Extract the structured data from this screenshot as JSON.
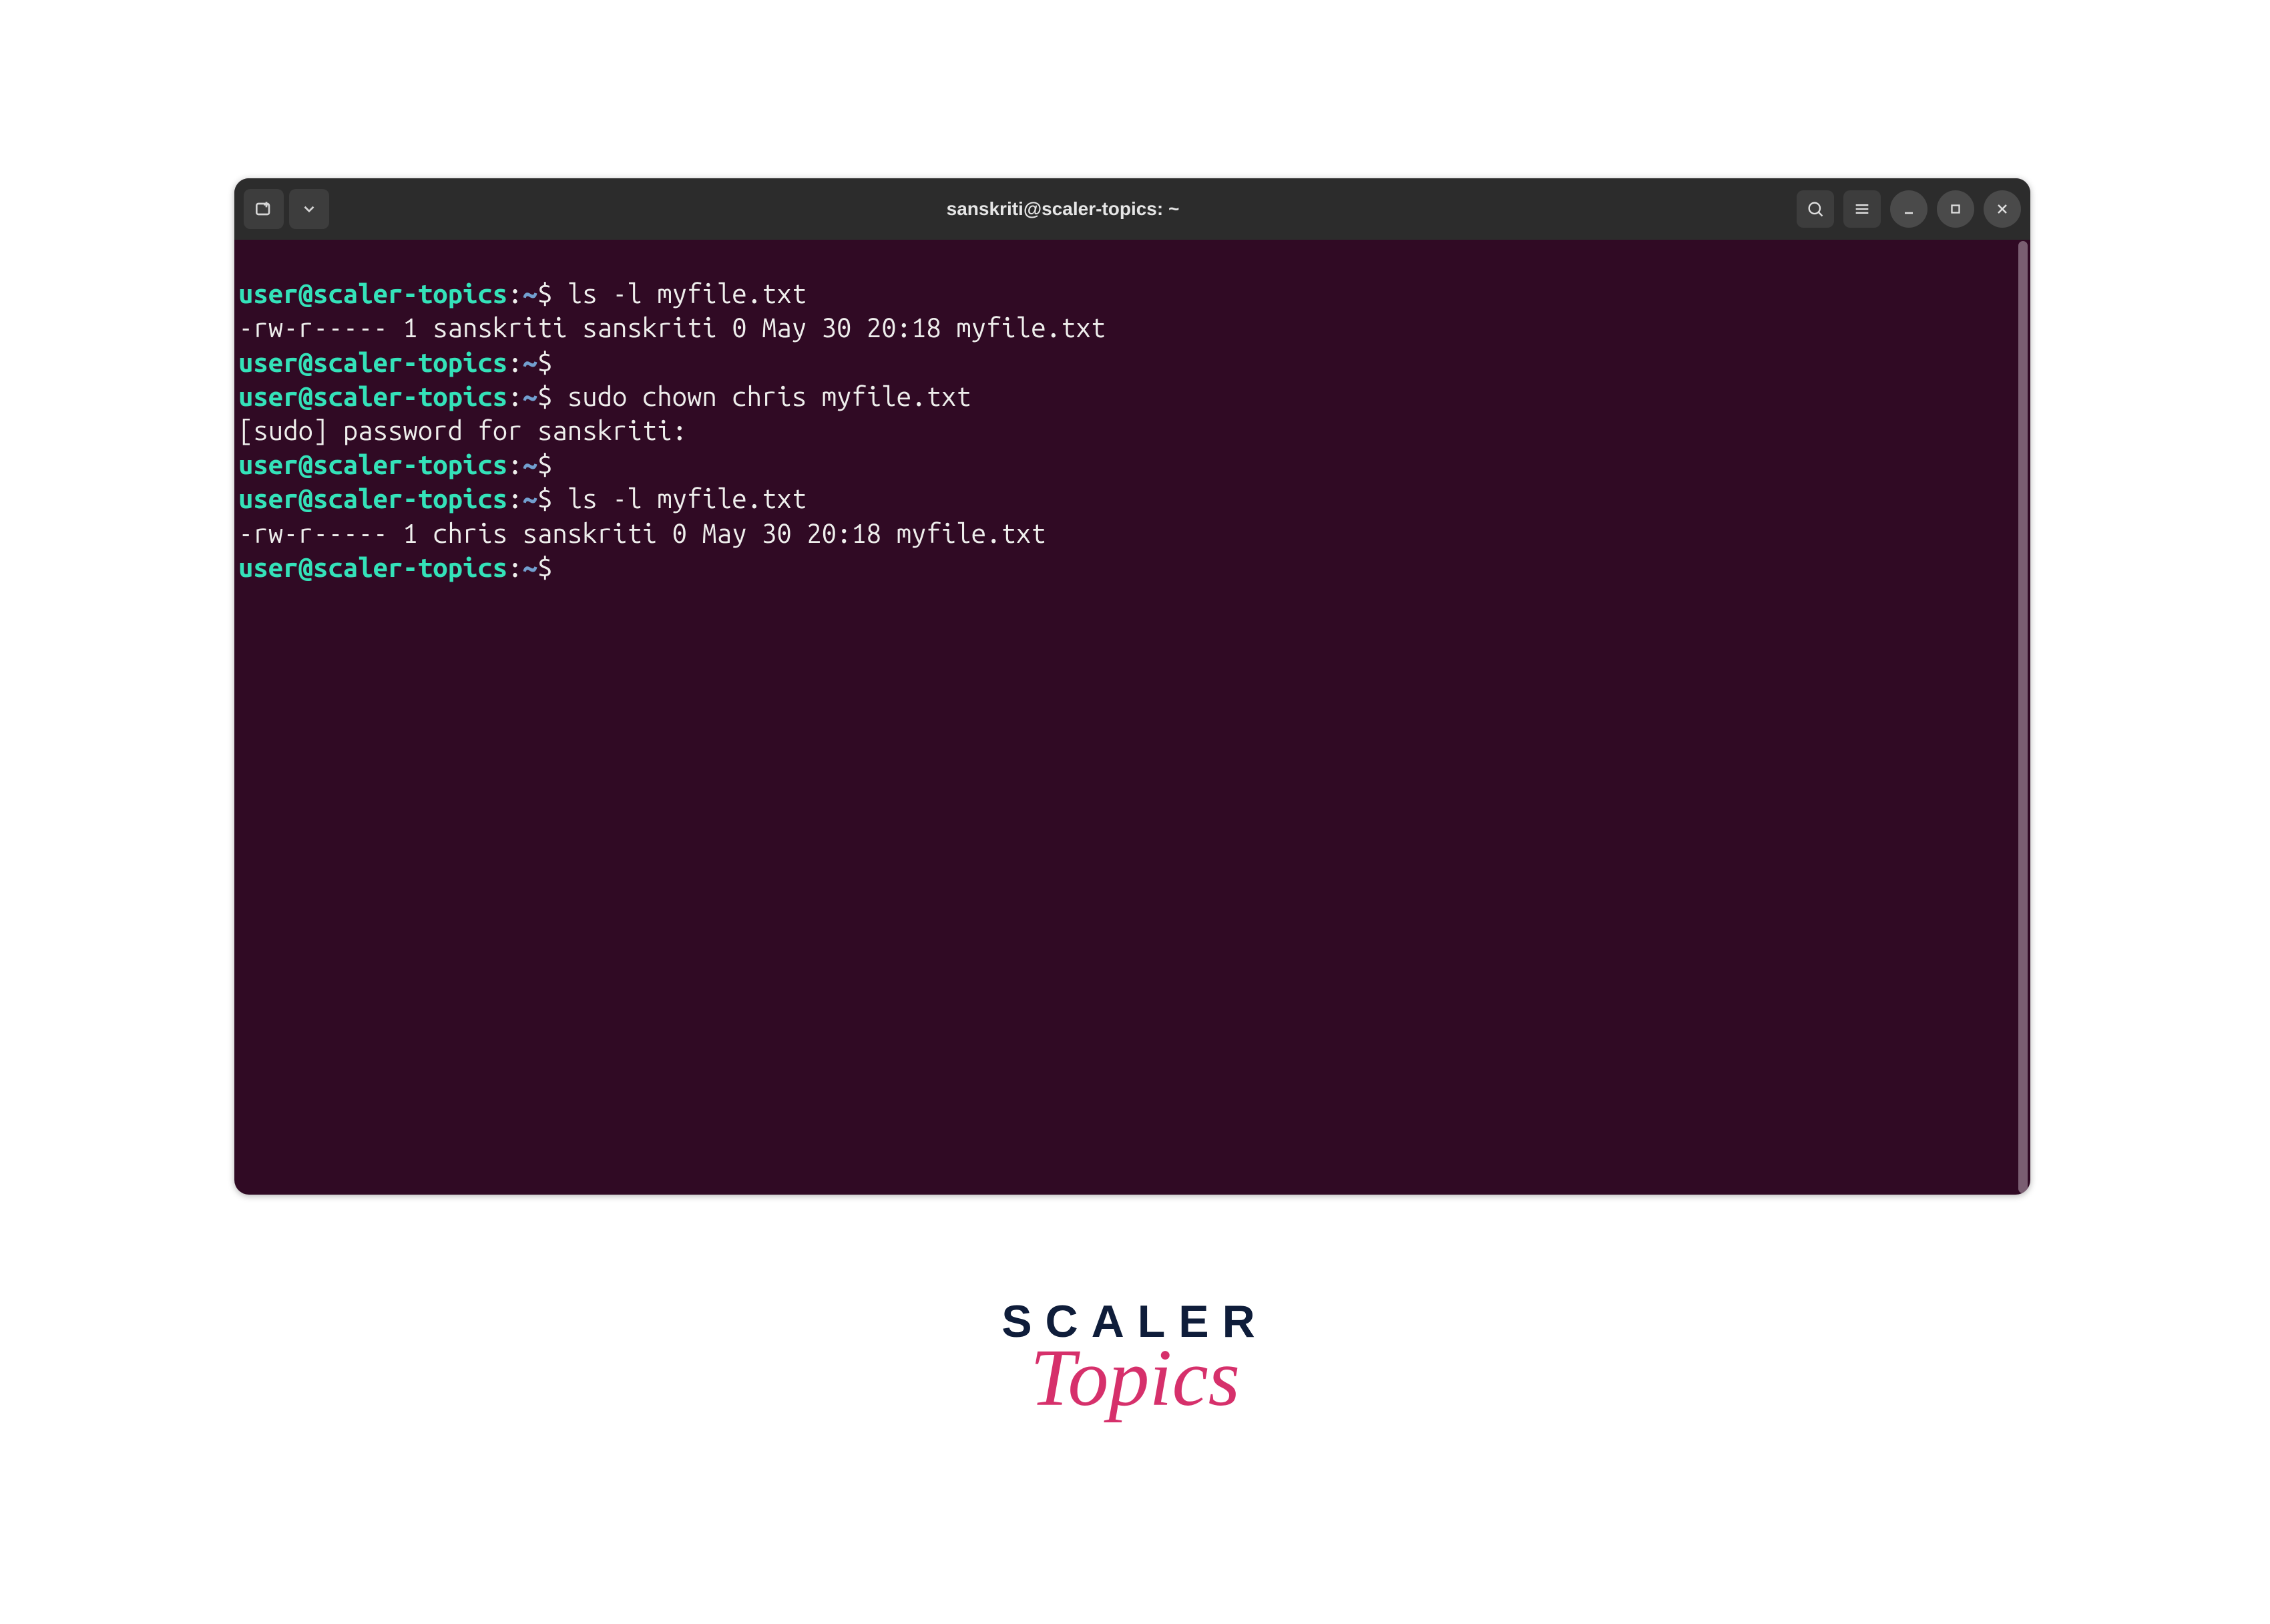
{
  "titlebar": {
    "title": "sanskriti@scaler-topics: ~"
  },
  "prompt": {
    "user_host": "user@scaler-topics",
    "colon": ":",
    "path": "~",
    "dollar": "$"
  },
  "lines": {
    "cmd1": " ls -l myfile.txt",
    "out1": "-rw-r----- 1 sanskriti sanskriti 0 May 30 20:18 myfile.txt",
    "cmd2": "",
    "cmd3": " sudo chown chris myfile.txt",
    "out3": "[sudo] password for sanskriti:",
    "cmd4": "",
    "cmd5": " ls -l myfile.txt",
    "out5": "-rw-r----- 1 chris sanskriti 0 May 30 20:18 myfile.txt",
    "cmd6": ""
  },
  "logo": {
    "line1": "SCALER",
    "line2": "Topics"
  }
}
